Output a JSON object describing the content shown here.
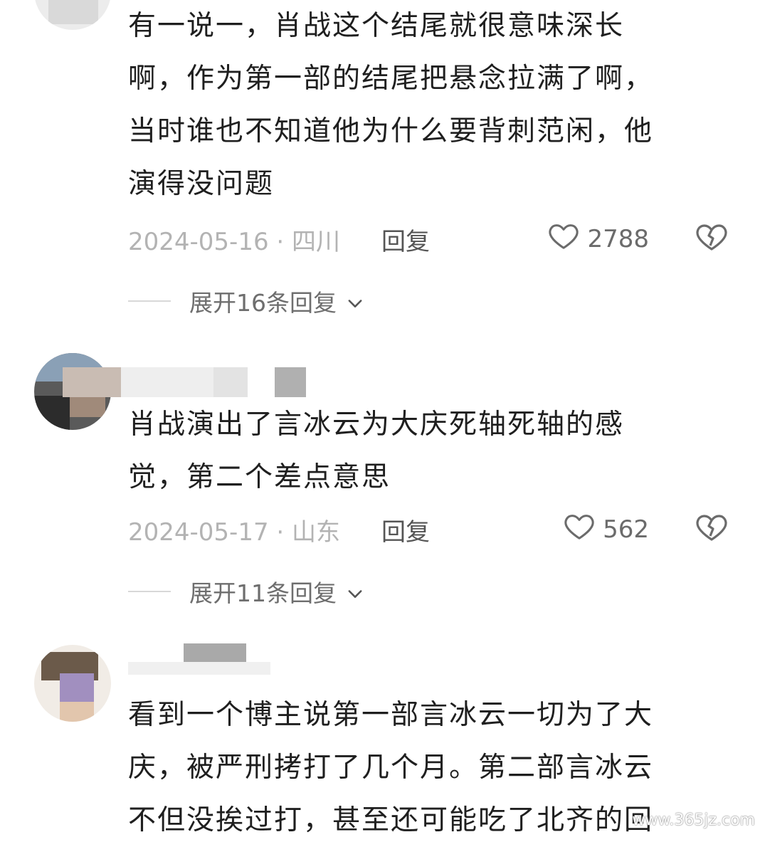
{
  "comments": [
    {
      "text": "有一说一，肖战这个结尾就很意味深长\n啊，作为第一部的结尾把悬念拉满了啊，\n当时谁也不知道他为什么要背刺范闲，他\n演得没问题",
      "date_location": "2024-05-16 · 四川",
      "reply_label": "回复",
      "likes": "2788",
      "expand_label": "展开16条回复"
    },
    {
      "text": "肖战演出了言冰云为大庆死轴死轴的感\n觉，第二个差点意思",
      "date_location": "2024-05-17 · 山东",
      "reply_label": "回复",
      "likes": "562",
      "expand_label": "展开11条回复"
    },
    {
      "text": "看到一个博主说第一部言冰云一切为了大\n庆，被严刑拷打了几个月。第二部言冰云\n不但没挨过打，甚至还可能吃了北齐的回"
    }
  ],
  "watermark": "www.365jz.com",
  "colors": {
    "meta_gray": "#b3b3b3",
    "reply_gray": "#555555",
    "icon_gray": "#6b6b6b"
  },
  "icons": {
    "like": "heart-outline-icon",
    "dislike": "broken-heart-icon",
    "expand": "chevron-down-icon"
  }
}
